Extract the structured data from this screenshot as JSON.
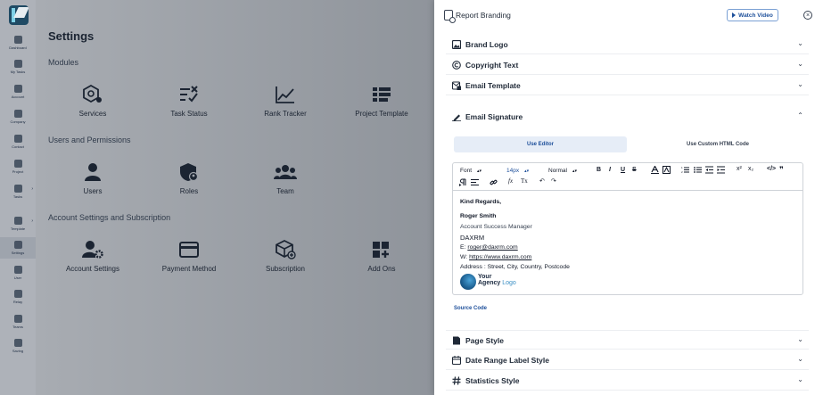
{
  "rail": {
    "items": [
      {
        "label": "Dashboard"
      },
      {
        "label": "My Tasks"
      },
      {
        "label": "Account"
      },
      {
        "label": "Company"
      },
      {
        "label": "Contact"
      },
      {
        "label": "Project"
      },
      {
        "label": "Tasks"
      },
      {
        "label": "Template"
      },
      {
        "label": "Settings"
      },
      {
        "label": "User"
      },
      {
        "label": "Relay"
      },
      {
        "label": "Teams"
      },
      {
        "label": "Saving"
      }
    ]
  },
  "main": {
    "title": "Settings",
    "sections": [
      {
        "title": "Modules",
        "tiles": [
          "Services",
          "Task Status",
          "Rank Tracker",
          "Project Template"
        ]
      },
      {
        "title": "Users and Permissions",
        "tiles": [
          "Users",
          "Roles",
          "Team"
        ]
      },
      {
        "title": "Account Settings and Subscription",
        "tiles": [
          "Account Settings",
          "Payment Method",
          "Subscription",
          "Add Ons"
        ]
      }
    ]
  },
  "panel": {
    "title": "Report Branding",
    "watch_video": "Watch Video",
    "close_glyph": "×",
    "sections": {
      "brand_logo": "Brand Logo",
      "copyright": "Copyright Text",
      "email_template": "Email Template",
      "email_signature": "Email Signature",
      "page_style": "Page Style",
      "date_range": "Date Range Label Style",
      "statistics": "Statistics Style"
    },
    "signature": {
      "tab_editor": "Use Editor",
      "tab_html": "Use Custom HTML Code",
      "toolbar": {
        "font": "Font",
        "size": "14px",
        "format": "Normal",
        "bold": "B",
        "italic": "I",
        "underline": "U",
        "strike": "S",
        "superscript": "x²",
        "subscript": "x₂",
        "code": "</>",
        "quote": "❞"
      },
      "content": {
        "greeting": "Kind Regards,",
        "name": "Roger Smith",
        "role": "Account Success Manager",
        "company": "DAXRM",
        "email_prefix": "E: ",
        "email": "roger@daxrm.com",
        "web_prefix": "W: ",
        "website": "https://www.daxrm.com",
        "address": "Address : Street, City, Country, Postcode",
        "logo_line1": "Your",
        "logo_line2": "Agency",
        "logo_line2b": "Logo"
      },
      "source_code": "Source Code"
    }
  },
  "colors": {
    "accent": "#1d4f9a",
    "tab_active_bg": "#e6edf7",
    "overlay": "#9ea3aa"
  }
}
